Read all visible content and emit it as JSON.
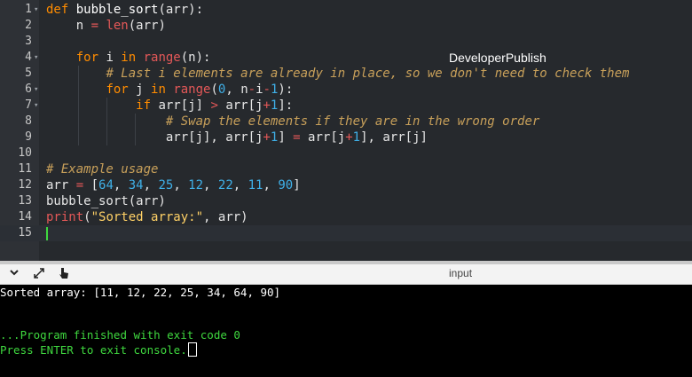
{
  "colors": {
    "keyword": "#ff8c00",
    "name": "#ffffff",
    "builtin": "#e45858",
    "number": "#3fb0e8",
    "string": "#ffd166",
    "comment": "#c8a05a",
    "console_text": "#ffffff",
    "console_green": "#3fd83f"
  },
  "editor": {
    "watermark": "DeveloperPublish",
    "lines": [
      {
        "no": "1",
        "fold": true,
        "tokens": [
          [
            "def ",
            "keyword"
          ],
          [
            "bubble_sort",
            "name"
          ],
          [
            "(arr):",
            "plain"
          ]
        ]
      },
      {
        "no": "2",
        "fold": false,
        "tokens": [
          [
            "    n ",
            "plain"
          ],
          [
            "= ",
            "op"
          ],
          [
            "len",
            "builtin"
          ],
          [
            "(arr)",
            "plain"
          ]
        ]
      },
      {
        "no": "3",
        "fold": false,
        "tokens": []
      },
      {
        "no": "4",
        "fold": true,
        "tokens": [
          [
            "    ",
            "plain"
          ],
          [
            "for ",
            "keyword"
          ],
          [
            "i ",
            "plain"
          ],
          [
            "in ",
            "keyword"
          ],
          [
            "range",
            "builtin"
          ],
          [
            "(n):",
            "plain"
          ]
        ]
      },
      {
        "no": "5",
        "fold": false,
        "tokens": [
          [
            "        ",
            "plain"
          ],
          [
            "# Last i elements are already in place, so we don't need to check them",
            "comment"
          ]
        ]
      },
      {
        "no": "6",
        "fold": true,
        "tokens": [
          [
            "        ",
            "plain"
          ],
          [
            "for ",
            "keyword"
          ],
          [
            "j ",
            "plain"
          ],
          [
            "in ",
            "keyword"
          ],
          [
            "range",
            "builtin"
          ],
          [
            "(",
            "plain"
          ],
          [
            "0",
            "number"
          ],
          [
            ", n",
            "plain"
          ],
          [
            "-",
            "op"
          ],
          [
            "i",
            "plain"
          ],
          [
            "-",
            "op"
          ],
          [
            "1",
            "number"
          ],
          [
            "):",
            "plain"
          ]
        ]
      },
      {
        "no": "7",
        "fold": true,
        "tokens": [
          [
            "            ",
            "plain"
          ],
          [
            "if ",
            "keyword"
          ],
          [
            "arr[j] ",
            "plain"
          ],
          [
            "> ",
            "op"
          ],
          [
            "arr[j",
            "plain"
          ],
          [
            "+",
            "op"
          ],
          [
            "1",
            "number"
          ],
          [
            "]:",
            "plain"
          ]
        ]
      },
      {
        "no": "8",
        "fold": false,
        "tokens": [
          [
            "                ",
            "plain"
          ],
          [
            "# Swap the elements if they are in the wrong order",
            "comment"
          ]
        ]
      },
      {
        "no": "9",
        "fold": false,
        "tokens": [
          [
            "                ",
            "plain"
          ],
          [
            "arr[j], arr[j",
            "plain"
          ],
          [
            "+",
            "op"
          ],
          [
            "1",
            "number"
          ],
          [
            "] ",
            "plain"
          ],
          [
            "= ",
            "op"
          ],
          [
            "arr[j",
            "plain"
          ],
          [
            "+",
            "op"
          ],
          [
            "1",
            "number"
          ],
          [
            "], arr[j]",
            "plain"
          ]
        ]
      },
      {
        "no": "10",
        "fold": false,
        "tokens": []
      },
      {
        "no": "11",
        "fold": false,
        "tokens": [
          [
            "# Example usage",
            "comment"
          ]
        ]
      },
      {
        "no": "12",
        "fold": false,
        "tokens": [
          [
            "arr ",
            "plain"
          ],
          [
            "= ",
            "op"
          ],
          [
            "[",
            "plain"
          ],
          [
            "64",
            "number"
          ],
          [
            ", ",
            "plain"
          ],
          [
            "34",
            "number"
          ],
          [
            ", ",
            "plain"
          ],
          [
            "25",
            "number"
          ],
          [
            ", ",
            "plain"
          ],
          [
            "12",
            "number"
          ],
          [
            ", ",
            "plain"
          ],
          [
            "22",
            "number"
          ],
          [
            ", ",
            "plain"
          ],
          [
            "11",
            "number"
          ],
          [
            ", ",
            "plain"
          ],
          [
            "90",
            "number"
          ],
          [
            "]",
            "plain"
          ]
        ]
      },
      {
        "no": "13",
        "fold": false,
        "tokens": [
          [
            "bubble_sort(arr)",
            "plain"
          ]
        ]
      },
      {
        "no": "14",
        "fold": false,
        "tokens": [
          [
            "print",
            "builtin"
          ],
          [
            "(",
            "plain"
          ],
          [
            "\"Sorted array:\"",
            "string"
          ],
          [
            ", arr)",
            "plain"
          ]
        ]
      },
      {
        "no": "15",
        "fold": false,
        "tokens": []
      }
    ]
  },
  "io_bar": {
    "label": "input",
    "icons": [
      "chevron-down-icon",
      "expand-icon",
      "pointer-icon"
    ]
  },
  "console": {
    "lines": [
      {
        "text": "Sorted array: [11, 12, 22, 25, 34, 64, 90]",
        "color": "white"
      },
      {
        "text": "",
        "color": "white"
      },
      {
        "text": "",
        "color": "white"
      },
      {
        "text": "...Program finished with exit code 0",
        "color": "green"
      },
      {
        "text": "Press ENTER to exit console.",
        "color": "green"
      }
    ]
  }
}
